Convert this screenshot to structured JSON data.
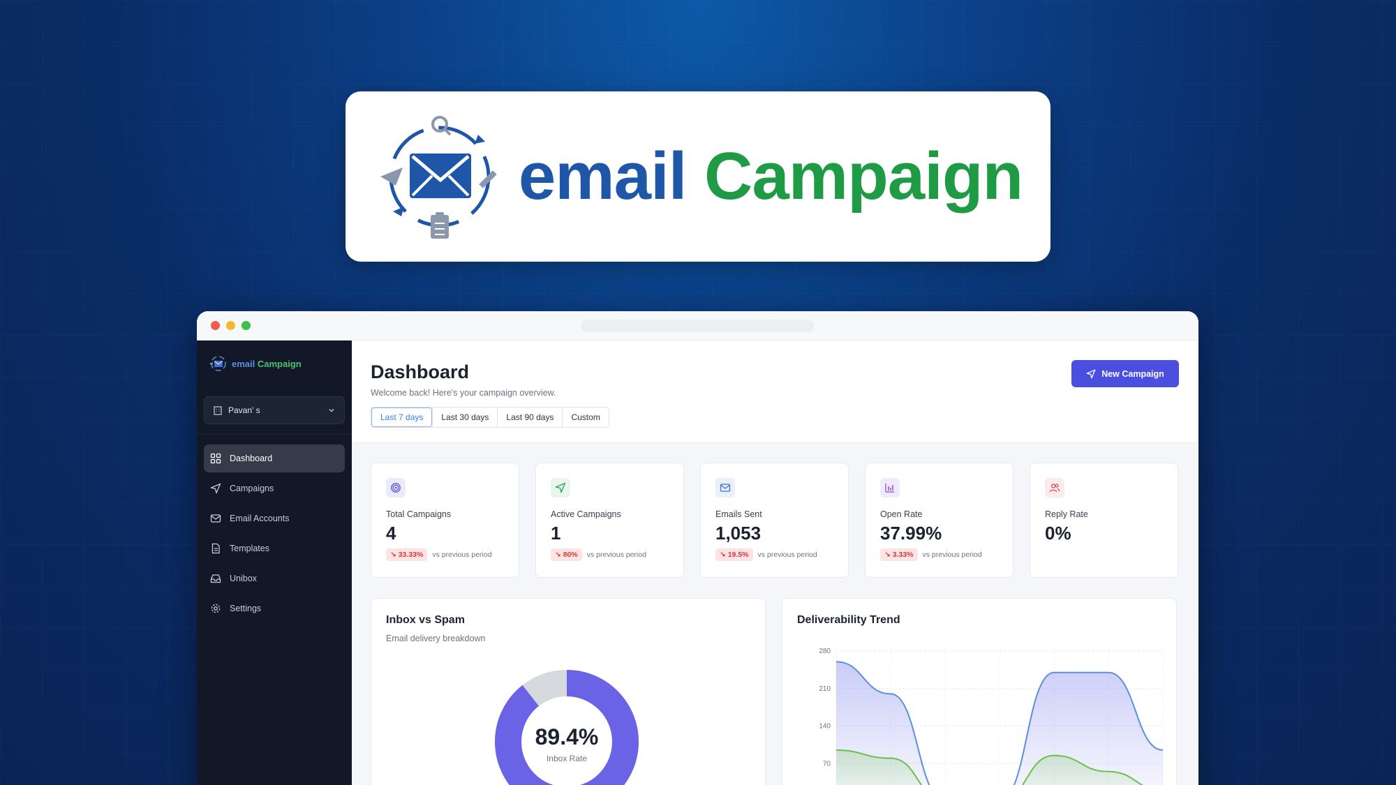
{
  "brand": {
    "word1": "email",
    "word2": "Campaign",
    "color1": "#1e56a8",
    "color2": "#1f9a45"
  },
  "sidebar": {
    "logo_word1": "email",
    "logo_word2": "Campaign",
    "org_name": "Pavan' s",
    "items": [
      {
        "label": "Dashboard",
        "icon": "grid-icon",
        "active": true
      },
      {
        "label": "Campaigns",
        "icon": "send-icon"
      },
      {
        "label": "Email Accounts",
        "icon": "mail-icon"
      },
      {
        "label": "Templates",
        "icon": "file-icon"
      },
      {
        "label": "Unibox",
        "icon": "inbox-icon"
      },
      {
        "label": "Settings",
        "icon": "gear-icon"
      }
    ]
  },
  "header": {
    "title": "Dashboard",
    "subtitle": "Welcome back! Here's your campaign overview.",
    "ranges": [
      "Last 7 days",
      "Last 30 days",
      "Last 90 days",
      "Custom"
    ],
    "active_range": "Last 7 days",
    "new_button": "New Campaign"
  },
  "stats": [
    {
      "label": "Total Campaigns",
      "value": "4",
      "delta": "33.33%",
      "delta_note": "vs previous period",
      "icon": "target-icon",
      "color": "#5b4fd8",
      "bg": "#ecebfb"
    },
    {
      "label": "Active Campaigns",
      "value": "1",
      "delta": "80%",
      "delta_note": "vs previous period",
      "icon": "send-icon",
      "color": "#28a05a",
      "bg": "#e8f6ee"
    },
    {
      "label": "Emails Sent",
      "value": "1,053",
      "delta": "19.5%",
      "delta_note": "vs previous period",
      "icon": "mail-icon",
      "color": "#3b6fd8",
      "bg": "#e9f0fc"
    },
    {
      "label": "Open Rate",
      "value": "37.99%",
      "delta": "3.33%",
      "delta_note": "vs previous period",
      "icon": "bar-chart-icon",
      "color": "#8a4fd8",
      "bg": "#f1eafc"
    },
    {
      "label": "Reply Rate",
      "value": "0%",
      "icon": "users-icon",
      "color": "#d8484f",
      "bg": "#fcebec"
    }
  ],
  "inbox_panel": {
    "title": "Inbox vs Spam",
    "subtitle": "Email delivery breakdown",
    "value": "89.4%",
    "value_label": "Inbox Rate",
    "inbox_fraction": 0.894,
    "inbox_color": "#6a63e6",
    "spam_color": "#d6d9de"
  },
  "trend_panel": {
    "title": "Deliverability Trend"
  },
  "chart_data": {
    "type": "area",
    "y_ticks": [
      280,
      210,
      140,
      70
    ],
    "ylim": [
      0,
      280
    ],
    "series": [
      {
        "color": "#5b8fe0",
        "values": [
          260,
          200,
          0,
          0,
          240,
          240,
          95
        ]
      },
      {
        "color": "#6cc049",
        "values": [
          95,
          80,
          0,
          0,
          85,
          55,
          20
        ]
      }
    ]
  }
}
